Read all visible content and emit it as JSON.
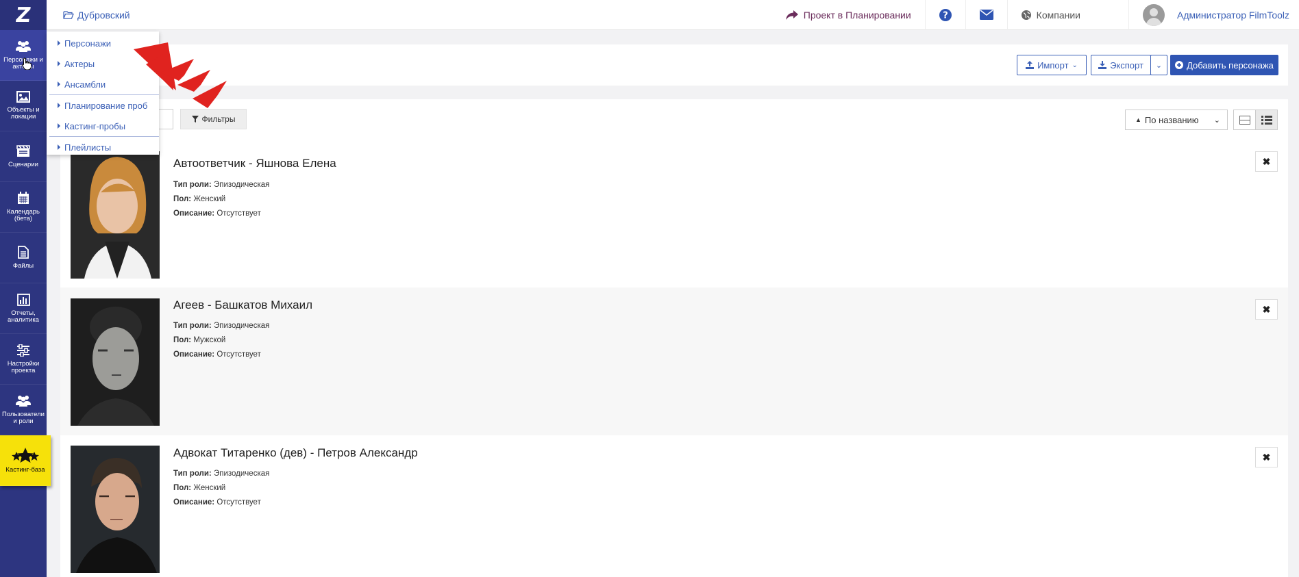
{
  "app": {
    "logo": "Z"
  },
  "sidebar": {
    "items": [
      {
        "label": "Персонажи и актеры",
        "icon": "users-icon"
      },
      {
        "label": "Объекты и локации",
        "icon": "image-icon"
      },
      {
        "label": "Сценарии",
        "icon": "clapperboard-icon"
      },
      {
        "label": "Календарь (бета)",
        "icon": "calendar-icon"
      },
      {
        "label": "Файлы",
        "icon": "file-icon"
      },
      {
        "label": "Отчеты, аналитика",
        "icon": "bar-chart-icon"
      },
      {
        "label": "Настройки проекта",
        "icon": "sliders-icon"
      },
      {
        "label": "Пользователи и роли",
        "icon": "users-icon"
      },
      {
        "label": "Кастинг-база",
        "icon": "stars-icon"
      }
    ]
  },
  "topbar": {
    "breadcrumb": "Дубровский",
    "project_status": "Проект в Планировании",
    "companies": "Компании",
    "user": "Администратор FilmToolz"
  },
  "toolbar": {
    "import_label": "Импорт",
    "export_label": "Экспорт",
    "add_label": "Добавить персонажа"
  },
  "filters": {
    "filters_label": "Фильтры",
    "sort_label": "По названию"
  },
  "dropdown": {
    "items": [
      "Персонажи",
      "Актеры",
      "Ансамбли",
      "Планирование проб",
      "Кастинг-пробы",
      "Плейлисты"
    ]
  },
  "fields": {
    "role_type": "Тип роли:",
    "gender": "Пол:",
    "description": "Описание:"
  },
  "cards": [
    {
      "title": "Автоответчик - Яшнова Елена",
      "role_type": "Эпизодическая",
      "gender": "Женский",
      "description": "Отсутствует"
    },
    {
      "title": "Агеев - Башкатов Михаил",
      "role_type": "Эпизодическая",
      "gender": "Мужской",
      "description": "Отсутствует"
    },
    {
      "title": "Адвокат Титаренко (дев) - Петров Александр",
      "role_type": "Эпизодическая",
      "gender": "Женский",
      "description": "Отсутствует"
    }
  ],
  "colors": {
    "sidebar": "#2d3580",
    "accent": "#3a5fb6",
    "primary_button": "#2f55b3",
    "casting_highlight": "#f6e10a",
    "arrow": "#e0231f"
  }
}
